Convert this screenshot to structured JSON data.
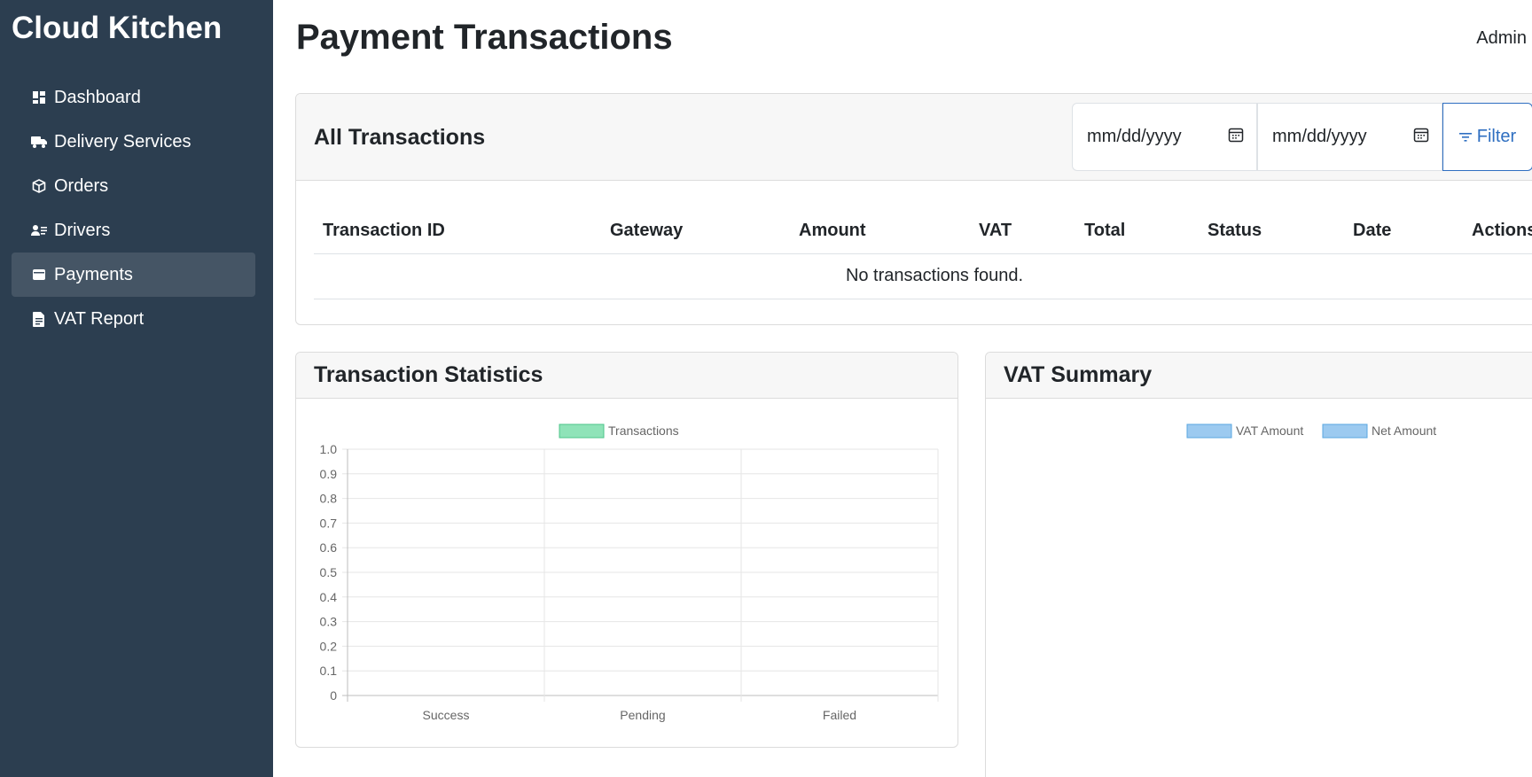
{
  "app": {
    "title": "Cloud Kitchen"
  },
  "sidebar": {
    "items": [
      {
        "label": "Dashboard",
        "icon": "dashboard-icon",
        "active": false
      },
      {
        "label": "Delivery Services",
        "icon": "truck-icon",
        "active": false
      },
      {
        "label": "Orders",
        "icon": "box-icon",
        "active": false
      },
      {
        "label": "Drivers",
        "icon": "person-list-icon",
        "active": false
      },
      {
        "label": "Payments",
        "icon": "wallet-icon",
        "active": true
      },
      {
        "label": "VAT Report",
        "icon": "file-text-icon",
        "active": false
      }
    ]
  },
  "header": {
    "title": "Payment Transactions",
    "user": "Admin"
  },
  "transactions": {
    "title": "All Transactions",
    "start_date": {
      "placeholder": "mm/dd/yyyy"
    },
    "end_date": {
      "placeholder": "mm/dd/yyyy"
    },
    "filter_label": "Filter",
    "columns": [
      "Transaction ID",
      "Gateway",
      "Amount",
      "VAT",
      "Total",
      "Status",
      "Date",
      "Actions"
    ],
    "empty_message": "No transactions found."
  },
  "stats": {
    "title": "Transaction Statistics"
  },
  "vat_summary": {
    "title": "VAT Summary"
  },
  "colors": {
    "sidebar_bg": "#2c3e50",
    "accent": "#2f6fc1",
    "transactions_series": "#8fe3b8",
    "vat_series": "#9ccaf0"
  },
  "chart_data": [
    {
      "type": "bar",
      "categories": [
        "Success",
        "Pending",
        "Failed"
      ],
      "series": [
        {
          "name": "Transactions",
          "values": [
            0,
            0,
            0
          ]
        }
      ],
      "ylim": [
        0,
        1.0
      ],
      "yticks": [
        "1.0",
        "0.9",
        "0.8",
        "0.7",
        "0.6",
        "0.5",
        "0.4",
        "0.3",
        "0.2",
        "0.1",
        "0"
      ],
      "grid": true,
      "legend": "top-center"
    },
    {
      "type": "pie",
      "series": [
        {
          "name": "VAT Amount",
          "values": []
        },
        {
          "name": "Net Amount",
          "values": []
        }
      ],
      "legend": "top-center"
    }
  ]
}
